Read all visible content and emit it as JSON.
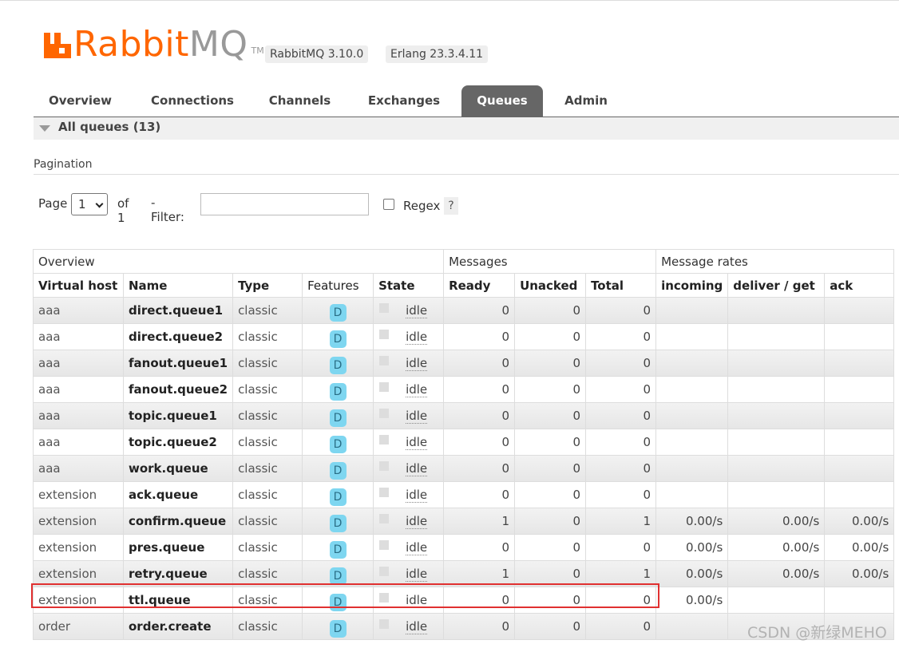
{
  "header": {
    "logo_text_brand": "Rabbit",
    "logo_text_mq": "MQ",
    "logo_tm": "TM",
    "rabbitmq_version": "RabbitMQ 3.10.0",
    "erlang_version": "Erlang 23.3.4.11",
    "brand_color": "#ff6600"
  },
  "nav": {
    "tabs": [
      {
        "label": "Overview",
        "active": false
      },
      {
        "label": "Connections",
        "active": false
      },
      {
        "label": "Channels",
        "active": false
      },
      {
        "label": "Exchanges",
        "active": false
      },
      {
        "label": "Queues",
        "active": true
      },
      {
        "label": "Admin",
        "active": false
      }
    ]
  },
  "section": {
    "title": "All queues (13)"
  },
  "pagination": {
    "title": "Pagination",
    "page_label": "Page",
    "page_value": "1",
    "of_label": "of 1",
    "filter_label": "- Filter:",
    "filter_value": "",
    "regex_label": "Regex",
    "regex_checked": false,
    "help_label": "?"
  },
  "table": {
    "groups": [
      "Overview",
      "Messages",
      "Message rates"
    ],
    "columns": [
      "Virtual host",
      "Name",
      "Type",
      "Features",
      "State",
      "Ready",
      "Unacked",
      "Total",
      "incoming",
      "deliver / get",
      "ack"
    ],
    "rows": [
      {
        "vhost": "aaa",
        "name": "direct.queue1",
        "type": "classic",
        "feature": "D",
        "state": "idle",
        "ready": "0",
        "unacked": "0",
        "total": "0",
        "incoming": "",
        "deliver": "",
        "ack": ""
      },
      {
        "vhost": "aaa",
        "name": "direct.queue2",
        "type": "classic",
        "feature": "D",
        "state": "idle",
        "ready": "0",
        "unacked": "0",
        "total": "0",
        "incoming": "",
        "deliver": "",
        "ack": ""
      },
      {
        "vhost": "aaa",
        "name": "fanout.queue1",
        "type": "classic",
        "feature": "D",
        "state": "idle",
        "ready": "0",
        "unacked": "0",
        "total": "0",
        "incoming": "",
        "deliver": "",
        "ack": ""
      },
      {
        "vhost": "aaa",
        "name": "fanout.queue2",
        "type": "classic",
        "feature": "D",
        "state": "idle",
        "ready": "0",
        "unacked": "0",
        "total": "0",
        "incoming": "",
        "deliver": "",
        "ack": ""
      },
      {
        "vhost": "aaa",
        "name": "topic.queue1",
        "type": "classic",
        "feature": "D",
        "state": "idle",
        "ready": "0",
        "unacked": "0",
        "total": "0",
        "incoming": "",
        "deliver": "",
        "ack": ""
      },
      {
        "vhost": "aaa",
        "name": "topic.queue2",
        "type": "classic",
        "feature": "D",
        "state": "idle",
        "ready": "0",
        "unacked": "0",
        "total": "0",
        "incoming": "",
        "deliver": "",
        "ack": ""
      },
      {
        "vhost": "aaa",
        "name": "work.queue",
        "type": "classic",
        "feature": "D",
        "state": "idle",
        "ready": "0",
        "unacked": "0",
        "total": "0",
        "incoming": "",
        "deliver": "",
        "ack": ""
      },
      {
        "vhost": "extension",
        "name": "ack.queue",
        "type": "classic",
        "feature": "D",
        "state": "idle",
        "ready": "0",
        "unacked": "0",
        "total": "0",
        "incoming": "",
        "deliver": "",
        "ack": ""
      },
      {
        "vhost": "extension",
        "name": "confirm.queue",
        "type": "classic",
        "feature": "D",
        "state": "idle",
        "ready": "1",
        "unacked": "0",
        "total": "1",
        "incoming": "0.00/s",
        "deliver": "0.00/s",
        "ack": "0.00/s"
      },
      {
        "vhost": "extension",
        "name": "pres.queue",
        "type": "classic",
        "feature": "D",
        "state": "idle",
        "ready": "0",
        "unacked": "0",
        "total": "0",
        "incoming": "0.00/s",
        "deliver": "0.00/s",
        "ack": "0.00/s"
      },
      {
        "vhost": "extension",
        "name": "retry.queue",
        "type": "classic",
        "feature": "D",
        "state": "idle",
        "ready": "1",
        "unacked": "0",
        "total": "1",
        "incoming": "0.00/s",
        "deliver": "0.00/s",
        "ack": "0.00/s"
      },
      {
        "vhost": "extension",
        "name": "ttl.queue",
        "type": "classic",
        "feature": "D",
        "state": "idle",
        "ready": "0",
        "unacked": "0",
        "total": "0",
        "incoming": "0.00/s",
        "deliver": "",
        "ack": ""
      },
      {
        "vhost": "order",
        "name": "order.create",
        "type": "classic",
        "feature": "D",
        "state": "idle",
        "ready": "0",
        "unacked": "0",
        "total": "0",
        "incoming": "",
        "deliver": "",
        "ack": ""
      }
    ],
    "highlight_color": "#e03030"
  },
  "watermark": "CSDN @新绿MEHO"
}
